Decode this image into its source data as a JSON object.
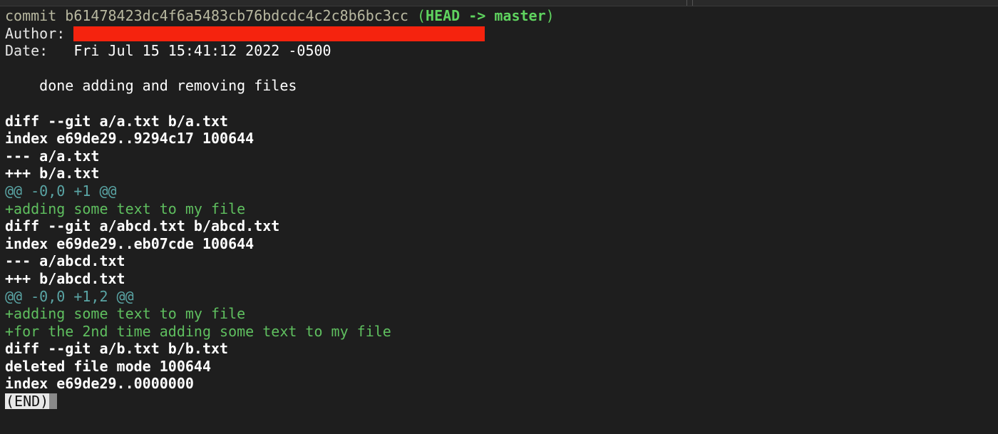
{
  "commit": {
    "label": "commit",
    "hash": "b61478423dc4f6a5483cb76bdcdc4c2c8b6bc3cc",
    "ref_open": "(",
    "head": "HEAD",
    "arrow": "->",
    "branch": "master",
    "ref_close": ")",
    "author_label": "Author:",
    "date_label": "Date:",
    "date_value": "Fri Jul 15 15:41:12 2022 -0500",
    "message": "done adding and removing files"
  },
  "diffs": [
    {
      "header": "diff --git a/a.txt b/a.txt",
      "index": "index e69de29..9294c17 100644",
      "minus": "--- a/a.txt",
      "plus": "+++ b/a.txt",
      "hunk": "@@ -0,0 +1 @@",
      "added": [
        "+adding some text to my file"
      ]
    },
    {
      "header": "diff --git a/abcd.txt b/abcd.txt",
      "index": "index e69de29..eb07cde 100644",
      "minus": "--- a/abcd.txt",
      "plus": "+++ b/abcd.txt",
      "hunk": "@@ -0,0 +1,2 @@",
      "added": [
        "+adding some text to my file",
        "+for the 2nd time adding some text to my file"
      ]
    },
    {
      "header": "diff --git a/b.txt b/b.txt",
      "deleted_mode": "deleted file mode 100644",
      "index": "index e69de29..0000000"
    }
  ],
  "pager": {
    "end_label": "(END)"
  },
  "colors": {
    "background": "#1e1e1e",
    "added": "#5fbf5f",
    "hunk": "#5aa5a5",
    "redaction": "#f5230e"
  }
}
